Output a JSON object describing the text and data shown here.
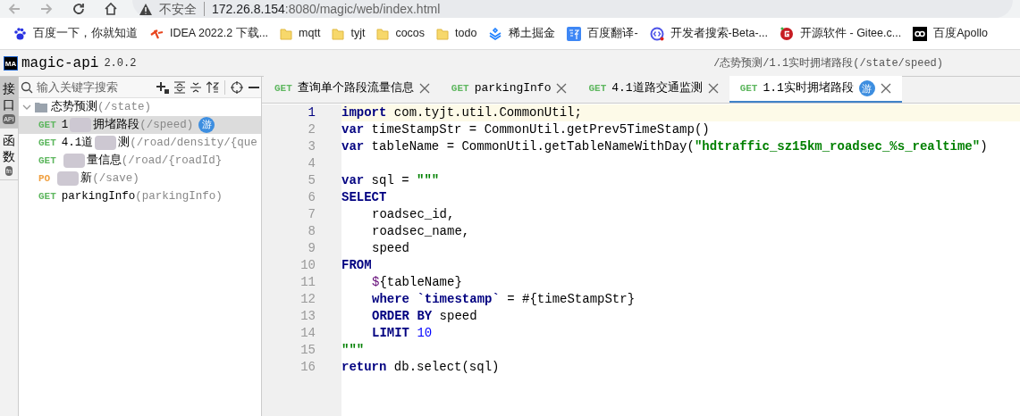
{
  "browser": {
    "security": "不安全",
    "url_host": "172.26.8.154",
    "url_rest": ":8080/magic/web/index.html"
  },
  "bookmarks": [
    {
      "kind": "paw",
      "label": "百度一下，你就知道"
    },
    {
      "kind": "idea",
      "label": "IDEA 2022.2 下载..."
    },
    {
      "kind": "folder",
      "label": "mqtt"
    },
    {
      "kind": "folder",
      "label": "tyjt"
    },
    {
      "kind": "folder",
      "label": "cocos"
    },
    {
      "kind": "folder",
      "label": "todo"
    },
    {
      "kind": "juejin",
      "label": "稀土掘金"
    },
    {
      "kind": "translate",
      "label": "百度翻译-"
    },
    {
      "kind": "devsearch",
      "label": "开发者搜索-Beta-..."
    },
    {
      "kind": "gitee",
      "label": "开源软件 - Gitee.c..."
    },
    {
      "kind": "apollo",
      "label": "百度Apollo"
    }
  ],
  "app": {
    "logo": "MA",
    "name": "magic-api",
    "version": "2.0.2",
    "breadcrumb": "/态势预测/1.1实时拥堵路段(/state/speed)"
  },
  "rail": [
    {
      "label": "接口",
      "badge": "API",
      "selected": true
    },
    {
      "label": "函数",
      "badge": "fn",
      "selected": false
    }
  ],
  "search": {
    "placeholder": "输入关键字搜索"
  },
  "tree": {
    "folder": "态势预测",
    "folder_path": "(/state)",
    "expanded": true,
    "children": [
      {
        "method": "GET",
        "before": "1",
        "after": "拥堵路段",
        "path": "(/speed)",
        "badge": "游",
        "selected": true,
        "redacted": true
      },
      {
        "method": "GET",
        "before": "4.1道",
        "after": "测",
        "path": "(/road/density/{que",
        "selected": false,
        "redacted": true
      },
      {
        "method": "GET",
        "after": "量信息",
        "path": "(/road/{roadId}",
        "selected": false,
        "redacted": true
      },
      {
        "method": "PO",
        "after": "新",
        "path": "(/save)",
        "selected": false,
        "redacted": true
      },
      {
        "method": "GET",
        "before": "parkingInfo",
        "path": "(parkingInfo)",
        "selected": false,
        "redacted": false
      }
    ]
  },
  "tabs": [
    {
      "method": "GET",
      "label": "查询单个路段流量信息",
      "selected": false
    },
    {
      "method": "GET",
      "label": "parkingInfo",
      "selected": false
    },
    {
      "method": "GET",
      "label": "4.1道路交通监测",
      "selected": false
    },
    {
      "method": "GET",
      "label": "1.1实时拥堵路段",
      "badge": "游",
      "selected": true
    }
  ],
  "code": [
    {
      "number": "1",
      "current": true,
      "indented": false,
      "tokens": [
        {
          "kind": "kw",
          "t": "import"
        },
        {
          "kind": "plain",
          "t": " com.tyjt.util.CommonUtil;"
        }
      ]
    },
    {
      "number": "2",
      "current": false,
      "indented": false,
      "tokens": [
        {
          "kind": "kw",
          "t": "var"
        },
        {
          "kind": "plain",
          "t": " timeStampStr = CommonUtil.getPrev5TimeStamp()"
        }
      ]
    },
    {
      "number": "3",
      "current": false,
      "indented": false,
      "tokens": [
        {
          "kind": "kw",
          "t": "var"
        },
        {
          "kind": "plain",
          "t": " tableName = CommonUtil.getTableNameWithDay("
        },
        {
          "kind": "str",
          "t": "\"hdtraffic_sz15km_roadsec_%s_realtime\""
        },
        {
          "kind": "plain",
          "t": ")"
        }
      ]
    },
    {
      "number": "4",
      "current": false
    },
    {
      "number": "5",
      "current": false,
      "indented": false,
      "tokens": [
        {
          "kind": "kw",
          "t": "var"
        },
        {
          "kind": "plain",
          "t": " sql = "
        },
        {
          "kind": "str",
          "t": "\"\"\""
        }
      ]
    },
    {
      "number": "6",
      "current": false,
      "indented": false,
      "tokens": [
        {
          "kind": "kw",
          "t": "SELECT"
        }
      ]
    },
    {
      "number": "7",
      "current": false,
      "indented": true,
      "tokens": [
        {
          "kind": "plain",
          "t": "roadsec_id,"
        }
      ]
    },
    {
      "number": "8",
      "current": false,
      "indented": true,
      "tokens": [
        {
          "kind": "plain",
          "t": "roadsec_name,"
        }
      ]
    },
    {
      "number": "9",
      "current": false,
      "indented": true,
      "tokens": [
        {
          "kind": "plain",
          "t": "speed"
        }
      ]
    },
    {
      "number": "10",
      "current": false,
      "indented": false,
      "tokens": [
        {
          "kind": "kw",
          "t": "FROM"
        }
      ]
    },
    {
      "number": "11",
      "current": false,
      "indented": true,
      "tokens": [
        {
          "kind": "var",
          "t": "$"
        },
        {
          "kind": "plain",
          "t": "{tableName}"
        }
      ]
    },
    {
      "number": "12",
      "current": false,
      "indented": true,
      "tokens": [
        {
          "kind": "kw",
          "t": "where"
        },
        {
          "kind": "kw",
          "t": " `timestamp`"
        },
        {
          "kind": "plain",
          "t": " = #{timeStampStr}"
        }
      ]
    },
    {
      "number": "13",
      "current": false,
      "indented": true,
      "tokens": [
        {
          "kind": "kw",
          "t": "ORDER BY"
        },
        {
          "kind": "plain",
          "t": " speed"
        }
      ]
    },
    {
      "number": "14",
      "current": false,
      "indented": true,
      "tokens": [
        {
          "kind": "kw",
          "t": "LIMIT"
        },
        {
          "kind": "num",
          "t": " 10"
        }
      ]
    },
    {
      "number": "15",
      "current": false,
      "indented": false,
      "tokens": [
        {
          "kind": "str",
          "t": "\"\"\""
        }
      ]
    },
    {
      "number": "16",
      "current": false,
      "indented": false,
      "tokens": [
        {
          "kind": "kw",
          "t": "return"
        },
        {
          "kind": "plain",
          "t": " db.select(sql)"
        }
      ]
    }
  ]
}
